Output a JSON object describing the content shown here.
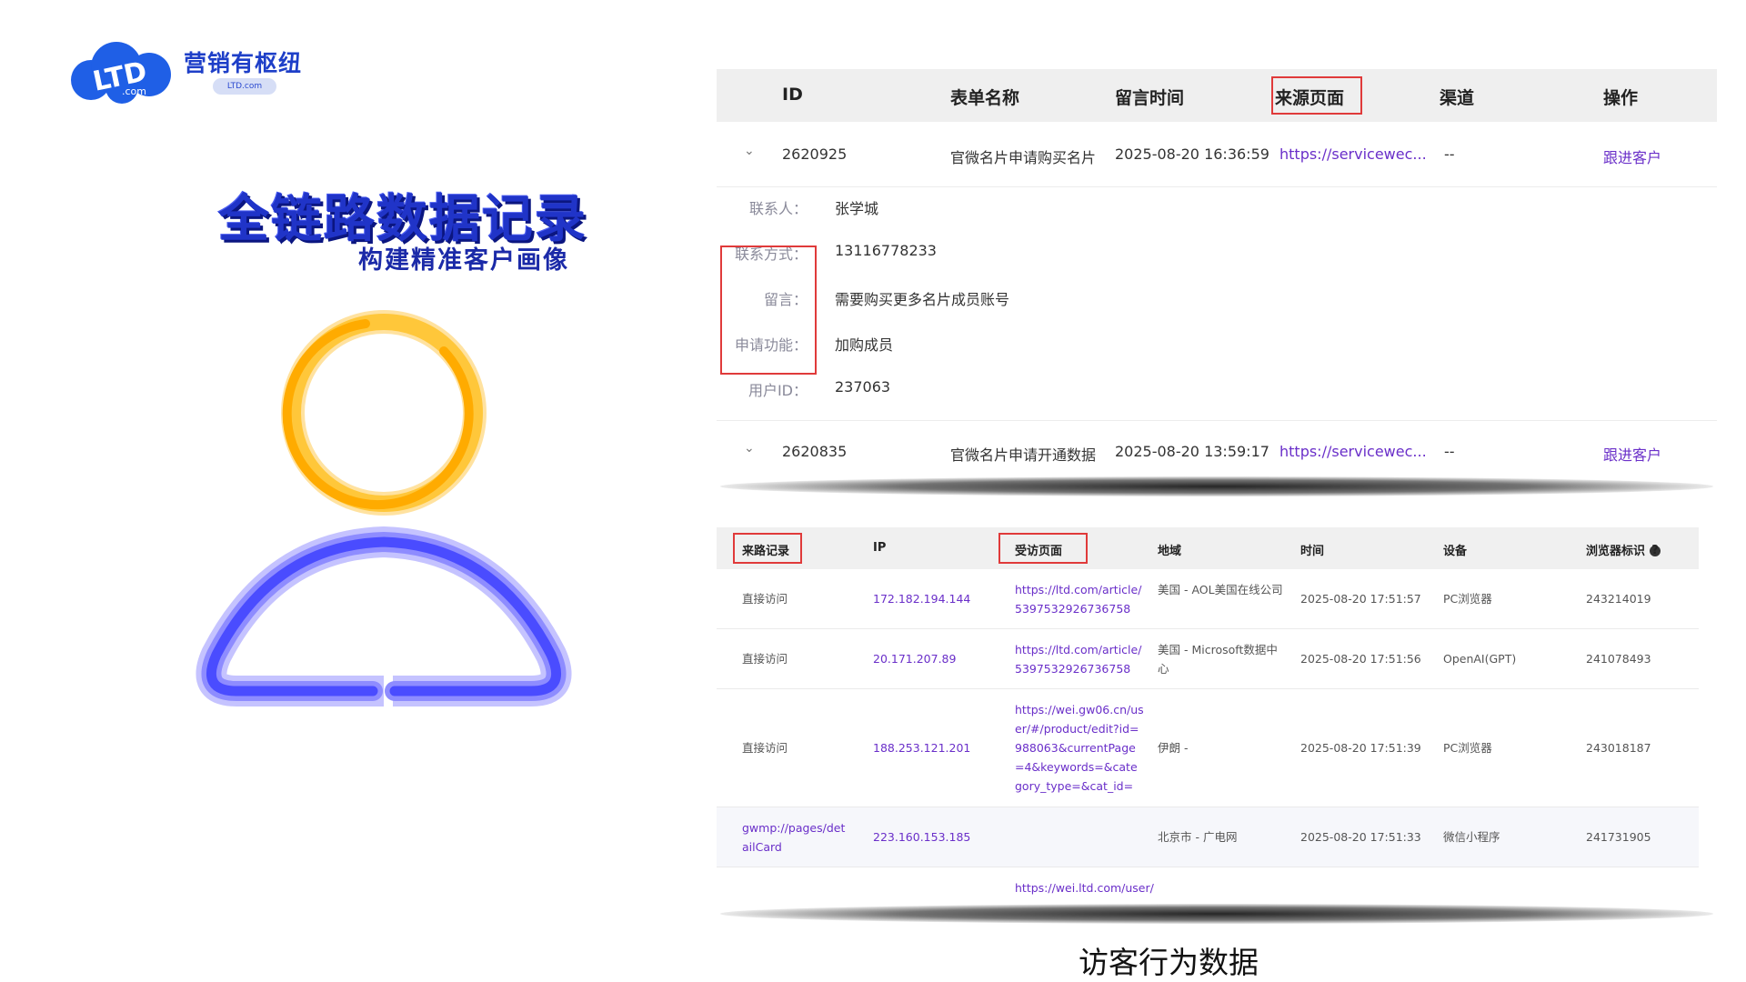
{
  "logo": {
    "mark": "LTD",
    "mark_sub": ".com",
    "name": "营销有枢纽",
    "domain": "LTD.com"
  },
  "headline": "全链路数据记录",
  "subline": "构建精准客户画像",
  "leads_table": {
    "columns": [
      "ID",
      "表单名称",
      "留言时间",
      "来源页面",
      "渠道",
      "操作"
    ],
    "rows": [
      {
        "id": "2620925",
        "form": "官微名片申请购买名片",
        "time": "2025-08-20 16:36:59",
        "source": "https://servicewec...",
        "channel": "--",
        "action": "跟进客户"
      },
      {
        "id": "2620835",
        "form": "官微名片申请开通数据",
        "time": "2025-08-20 13:59:17",
        "source": "https://servicewec...",
        "channel": "--",
        "action": "跟进客户"
      }
    ],
    "detail": [
      {
        "label": "联系人：",
        "value": "张学城"
      },
      {
        "label": "联系方式：",
        "value": "13116778233"
      },
      {
        "label": "留言：",
        "value": "需要购买更多名片成员账号"
      },
      {
        "label": "申请功能：",
        "value": "加购成员"
      },
      {
        "label": "用户ID：",
        "value": "237063"
      }
    ]
  },
  "visits_table": {
    "columns": [
      "来路记录",
      "IP",
      "受访页面",
      "地域",
      "时间",
      "设备",
      "浏览器标识"
    ],
    "help_icon": "question-icon",
    "rows": [
      {
        "referrer": "直接访问",
        "ip": "172.182.194.144",
        "page": "https://ltd.com/article/5397532926736758",
        "region": "美国 - AOL美国在线公司",
        "time": "2025-08-20 17:51:57",
        "device": "PC浏览器",
        "browser_id": "243214019"
      },
      {
        "referrer": "直接访问",
        "ip": "20.171.207.89",
        "page": "https://ltd.com/article/5397532926736758",
        "region": "美国 - Microsoft数据中心",
        "time": "2025-08-20 17:51:56",
        "device": "OpenAI(GPT)",
        "browser_id": "241078493"
      },
      {
        "referrer": "直接访问",
        "ip": "188.253.121.201",
        "page": "https://wei.gw06.cn/user/#/product/edit?id=988063&currentPage=4&keywords=&category_type=&cat_id=",
        "region": "伊朗 -",
        "time": "2025-08-20 17:51:39",
        "device": "PC浏览器",
        "browser_id": "243018187"
      },
      {
        "referrer": "gwmp://pages/detailCard",
        "ip": "223.160.153.185",
        "page": "",
        "region": "北京市 - 广电网",
        "time": "2025-08-20 17:51:33",
        "device": "微信小程序",
        "browser_id": "241731905"
      },
      {
        "referrer": "",
        "ip": "",
        "page": "https://wei.ltd.com/user/",
        "region": "",
        "time": "",
        "device": "",
        "browser_id": ""
      }
    ]
  },
  "caption": "访客行为数据",
  "colors": {
    "brand_blue": "#1e3fc8",
    "link_purple": "#6a2fc9",
    "highlight_red": "#e03a3a",
    "ring_orange": "#ffb000",
    "body_blue": "#4a4cff"
  }
}
